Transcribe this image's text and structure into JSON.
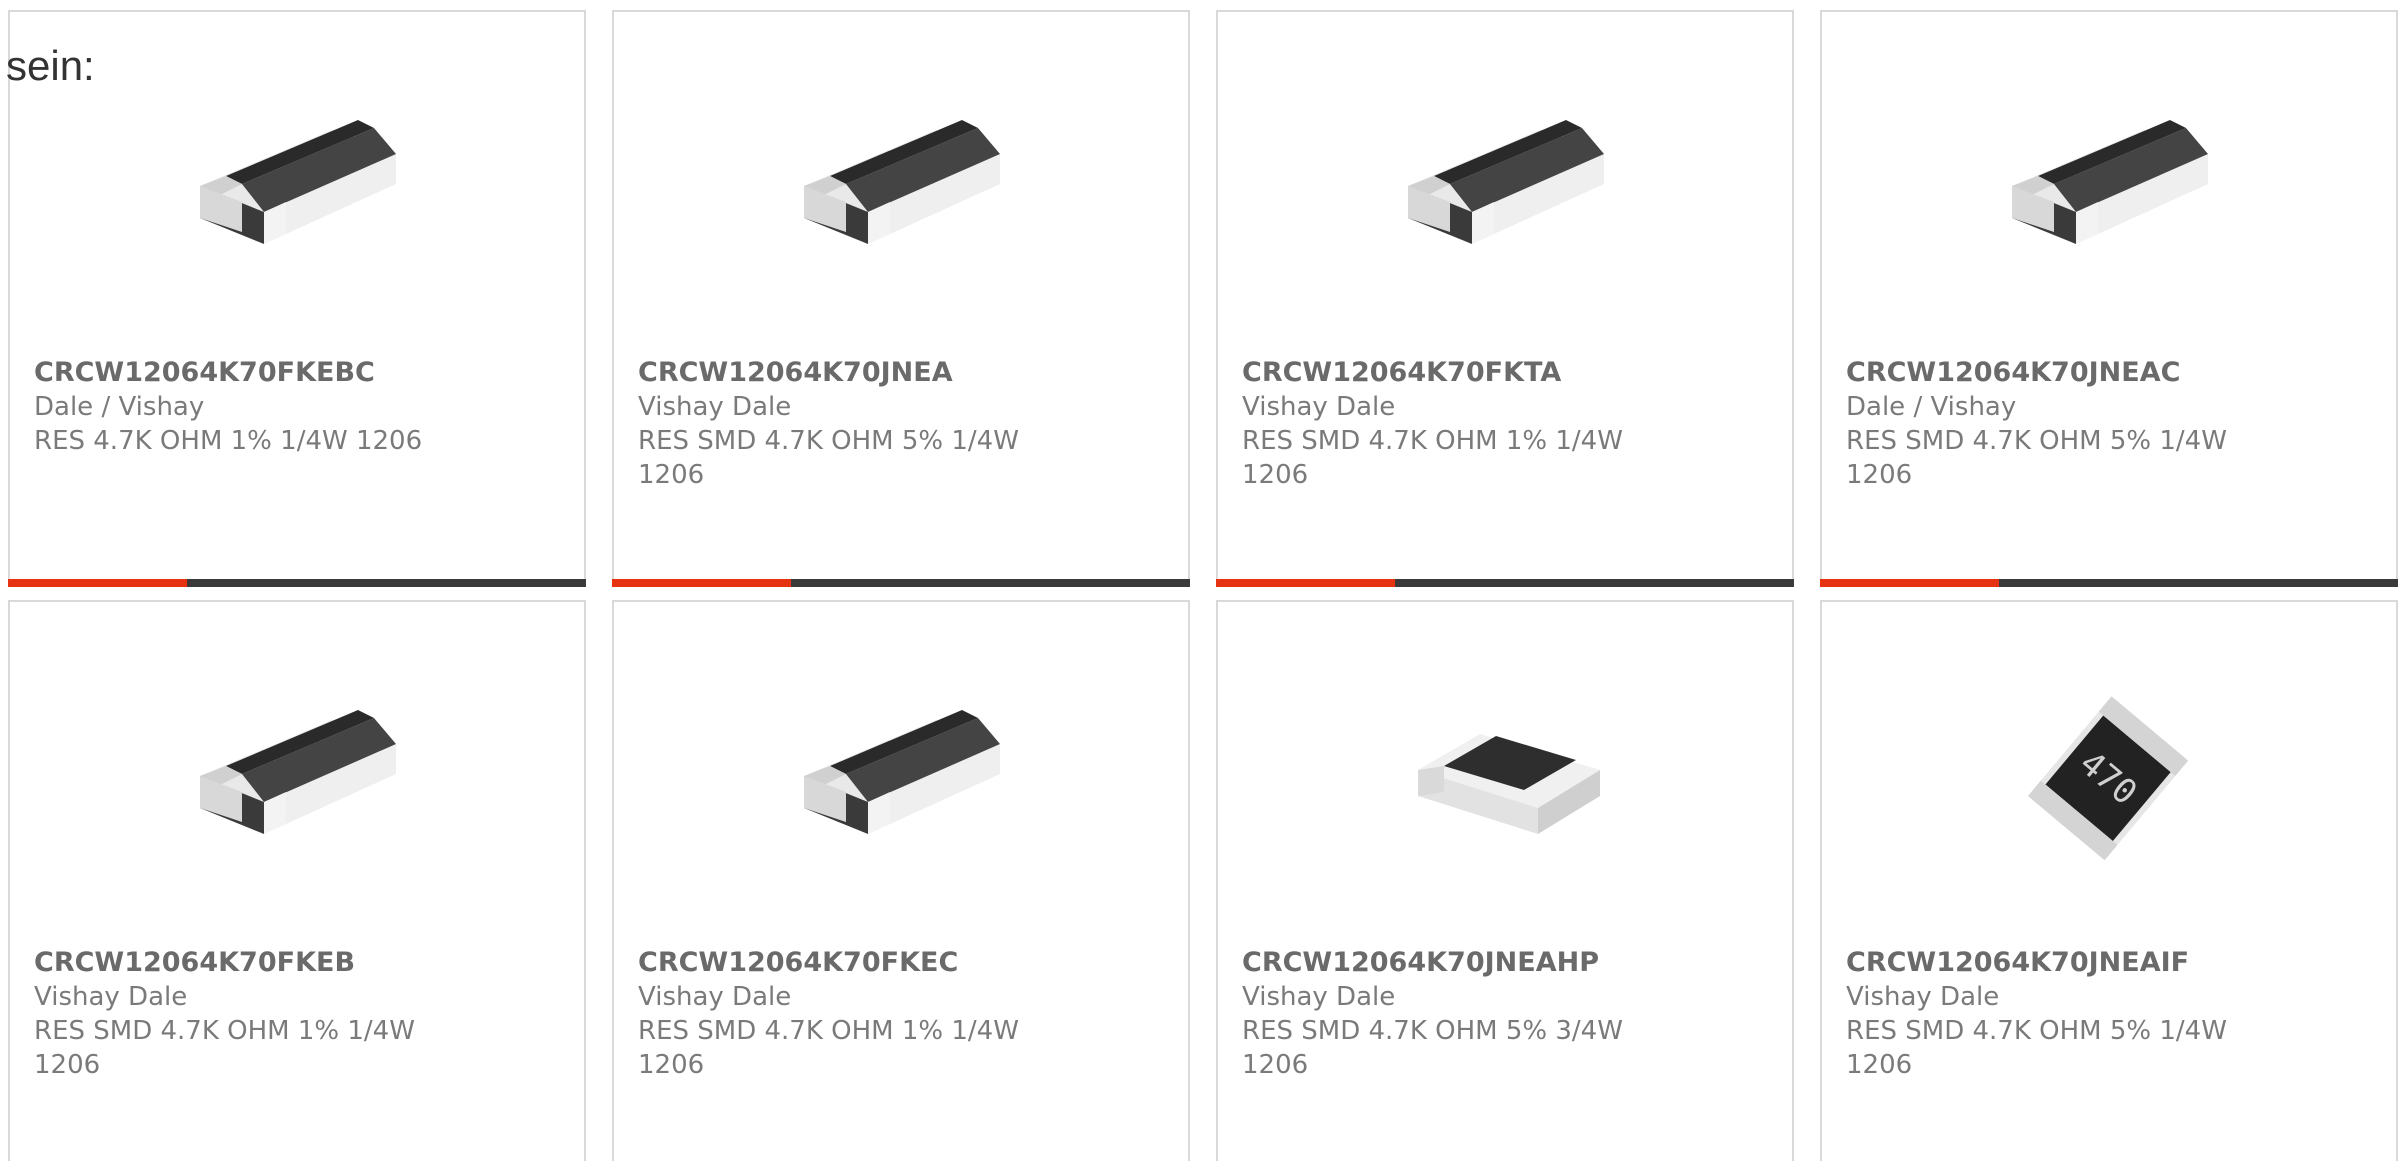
{
  "intro_text": "sein:",
  "colors": {
    "accent": "#e63312",
    "bar_dark": "#3a3a3a",
    "card_border": "#d9d9d9",
    "text": "#7a7a7a"
  },
  "cards": [
    {
      "part_number": "CRCW12064K70FKEBC",
      "manufacturer": "Dale / Vishay",
      "description": "RES 4.7K OHM 1% 1/4W 1206",
      "image": "black-chip-resistor",
      "hover_progress": 0.31
    },
    {
      "part_number": "CRCW12064K70JNEA",
      "manufacturer": "Vishay Dale",
      "description": "RES SMD 4.7K OHM 5% 1/4W 1206",
      "image": "black-chip-resistor",
      "hover_progress": 0.31
    },
    {
      "part_number": "CRCW12064K70FKTA",
      "manufacturer": "Vishay Dale",
      "description": "RES SMD 4.7K OHM 1% 1/4W 1206",
      "image": "black-chip-resistor",
      "hover_progress": 0.31
    },
    {
      "part_number": "CRCW12064K70JNEAC",
      "manufacturer": "Dale / Vishay",
      "description": "RES SMD 4.7K OHM 5% 1/4W 1206",
      "image": "black-chip-resistor",
      "hover_progress": 0.31
    },
    {
      "part_number": "CRCW12064K70FKEB",
      "manufacturer": "Vishay Dale",
      "description": "RES SMD 4.7K OHM 1% 1/4W 1206",
      "image": "black-chip-resistor"
    },
    {
      "part_number": "CRCW12064K70FKEC",
      "manufacturer": "Vishay Dale",
      "description": "RES SMD 4.7K OHM 1% 1/4W 1206",
      "image": "black-chip-resistor"
    },
    {
      "part_number": "CRCW12064K70JNEAHP",
      "manufacturer": "Vishay Dale",
      "description": "RES SMD 4.7K OHM 5% 3/4W 1206",
      "image": "wide-chip-resistor"
    },
    {
      "part_number": "CRCW12064K70JNEAIF",
      "manufacturer": "Vishay Dale",
      "description": "RES SMD 4.7K OHM 5% 1/4W 1206",
      "image": "marked-chip-resistor",
      "marking": "470"
    }
  ]
}
